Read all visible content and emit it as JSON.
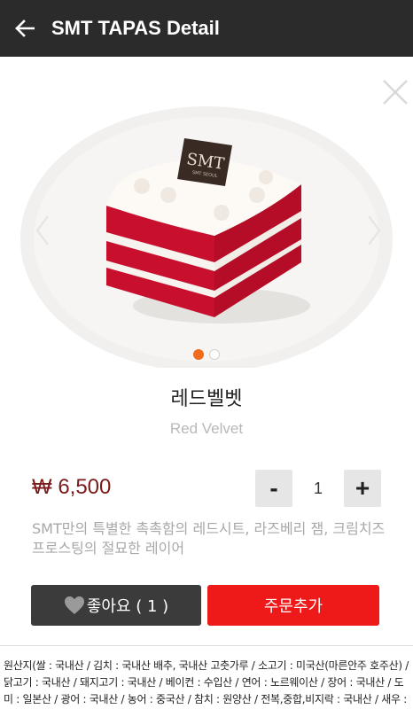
{
  "appbar": {
    "title": "SMT TAPAS Detail",
    "back_icon": "arrow-left-icon"
  },
  "slider": {
    "image_description_icon": "cake-photo",
    "logo_text": "SMT",
    "logo_sub": "SMT SEOUL",
    "dot_count": 2,
    "active_dot": 0,
    "accent_color": "#f26b1d"
  },
  "product": {
    "name_ko": "레드벨벳",
    "name_en": "Red Velvet",
    "price": "₩ 6,500",
    "description": "SMT만의 특별한 촉촉함의 레드시트, 라즈베리 잼, 크림치즈 프로스팅의 절묘한 레이어"
  },
  "quantity": {
    "minus_label": "-",
    "value": "1",
    "plus_label": "+"
  },
  "actions": {
    "like_label": "좋아요 ( 1 )",
    "order_label": "주문추가",
    "order_color": "#ee1a1a"
  },
  "origin_text": "원산지(쌀 : 국내산 / 김치 : 국내산 배추, 국내산 고춧가루 / 소고기 : 미국산(마른안주 호주산) / 닭고기 : 국내산 / 돼지고기 : 국내산 / 베이컨 : 수입산 / 연어 : 노르웨이산 / 장어 : 국내산 / 도미 : 일본산 / 광어 : 국내산 / 농어 : 중국산 / 참치 : 원양산 / 전복,중합,비지락 : 국내산 / 새우 : 중국산, 베트남산 / 가리비 : 국내산 오징어 : 국내산(동유럽산 국내 가공) / 문어 : 국내산 / 골뱅이"
}
